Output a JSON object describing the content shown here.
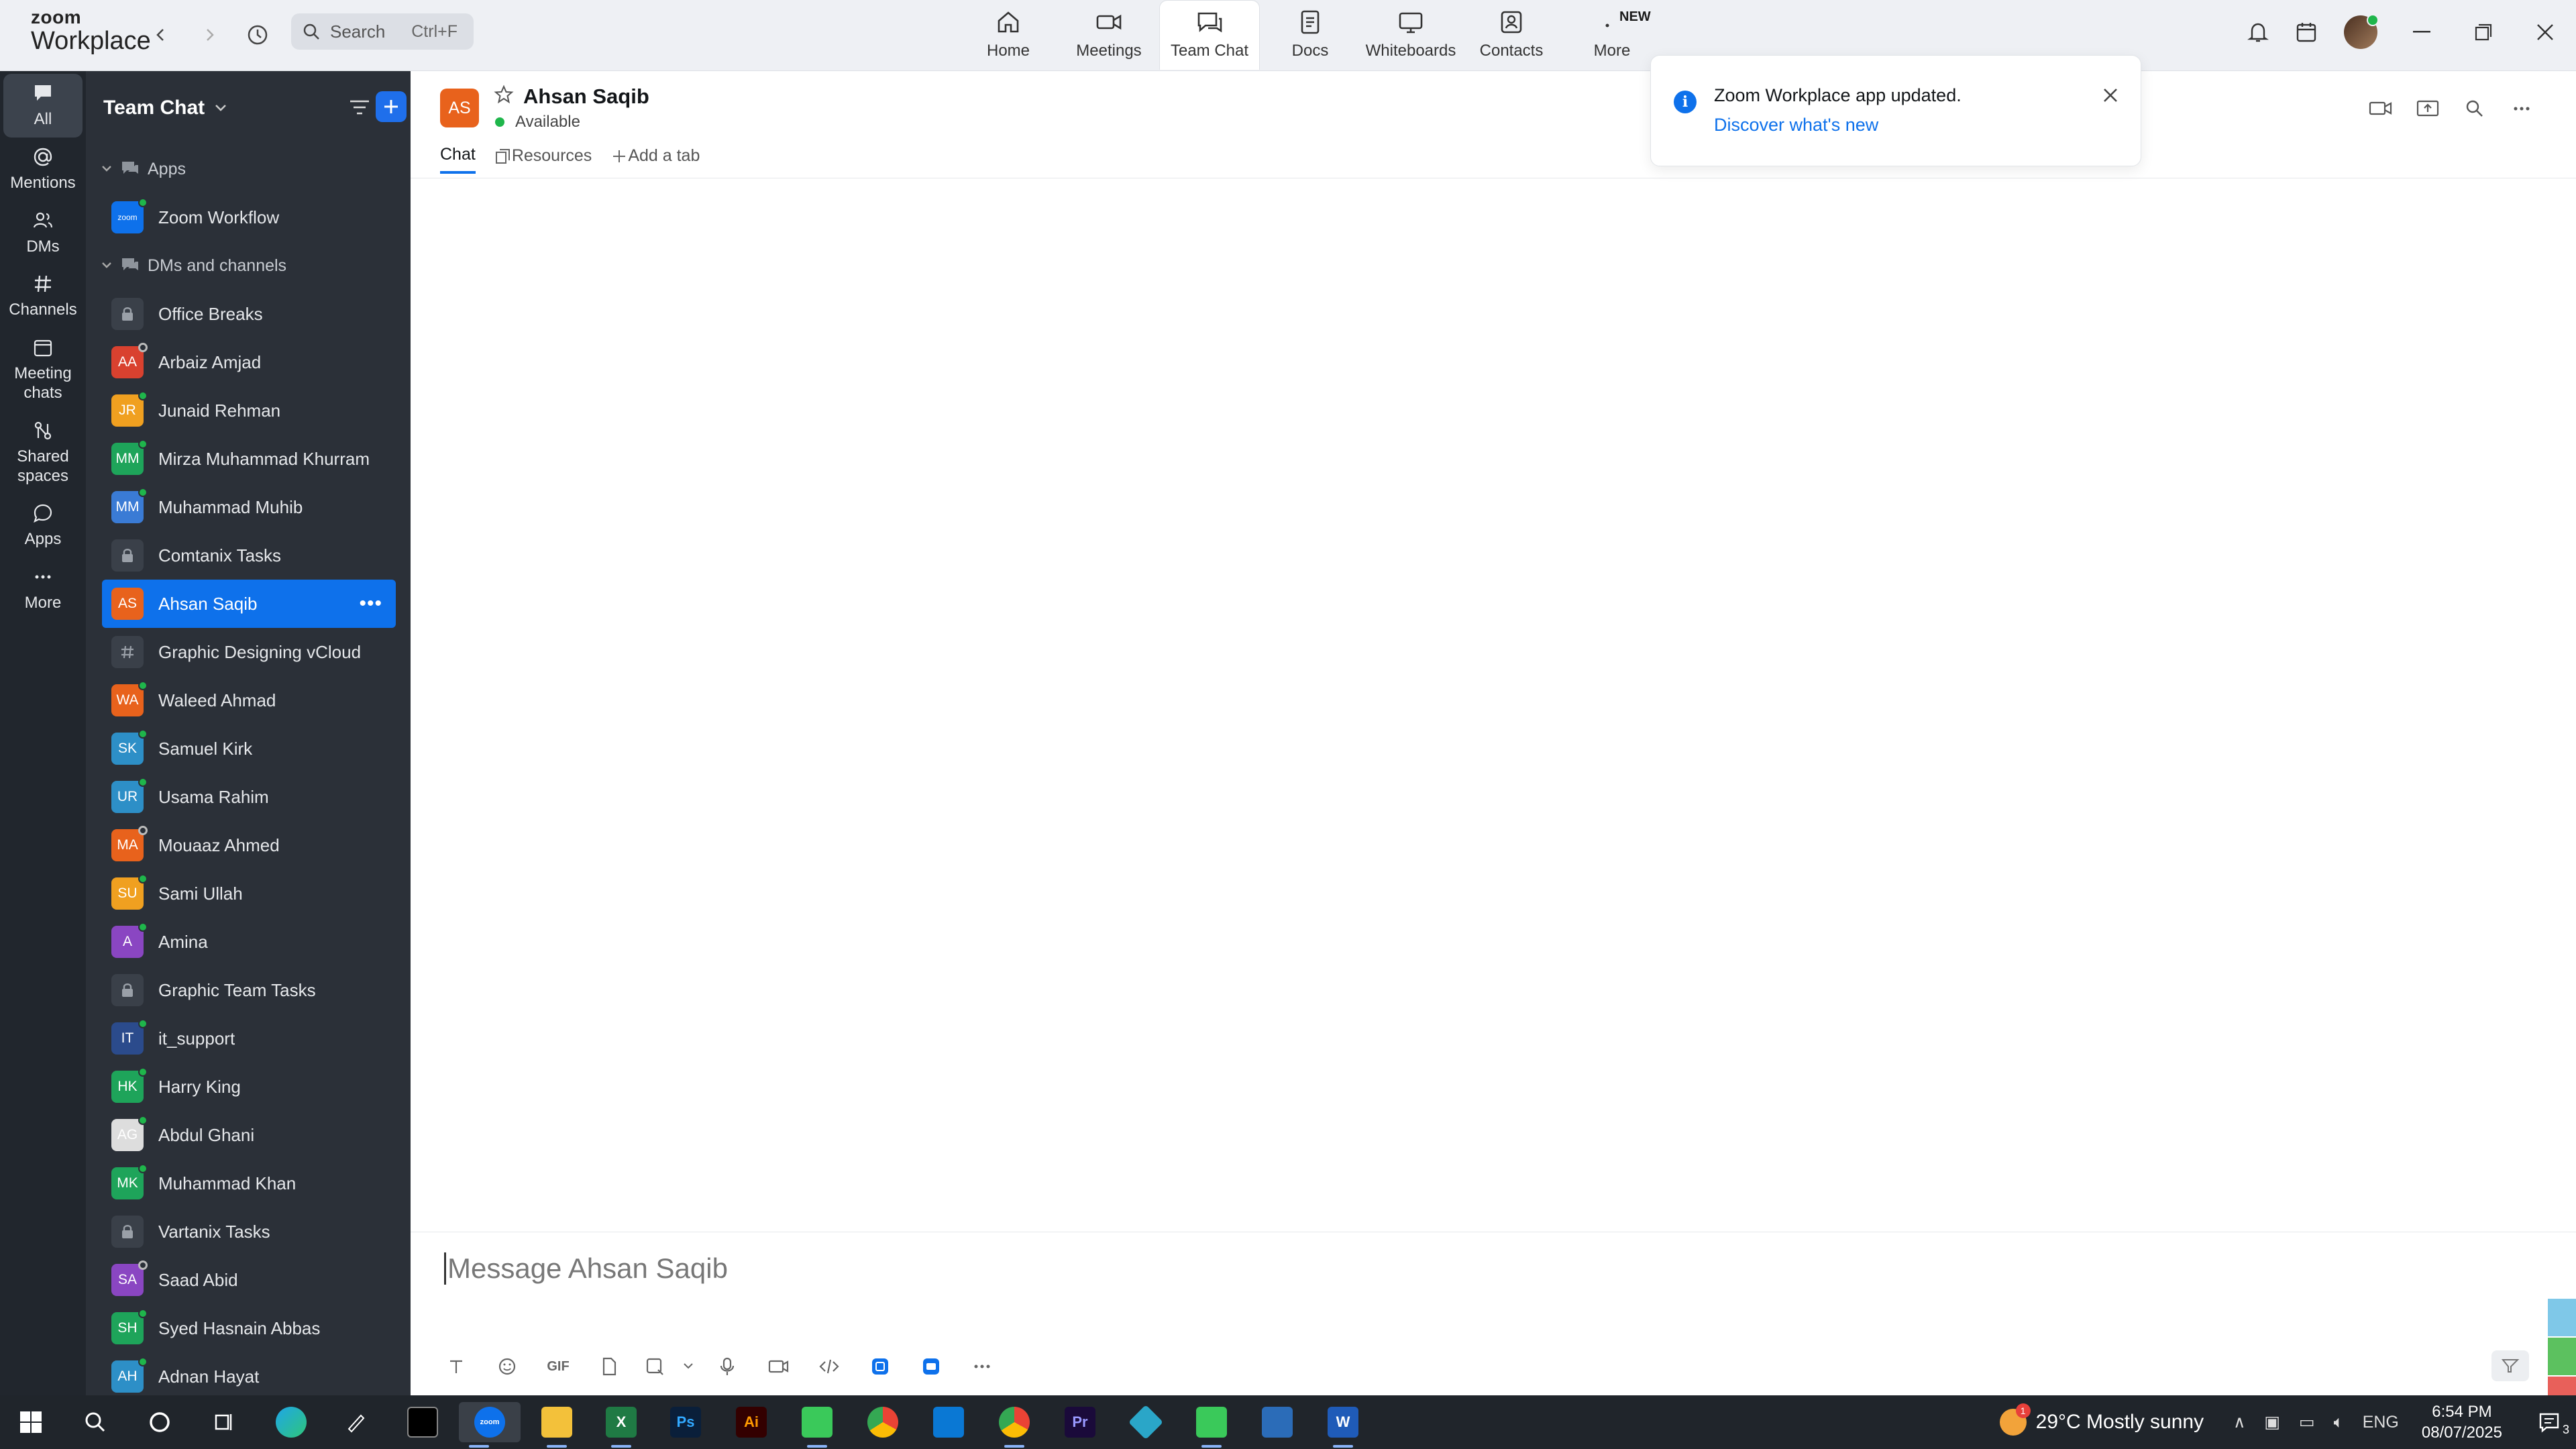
{
  "app": {
    "logo_line1": "zoom",
    "logo_line2": "Workplace"
  },
  "search": {
    "placeholder": "Search",
    "shortcut": "Ctrl+F"
  },
  "topnav": [
    {
      "label": "Home",
      "icon": "home-icon"
    },
    {
      "label": "Meetings",
      "icon": "video-camera-icon"
    },
    {
      "label": "Team Chat",
      "icon": "chat-bubble-icon",
      "active": true
    },
    {
      "label": "Docs",
      "icon": "document-icon"
    },
    {
      "label": "Whiteboards",
      "icon": "whiteboard-icon"
    },
    {
      "label": "Contacts",
      "icon": "contact-card-icon"
    },
    {
      "label": "More",
      "icon": "more-dots-icon",
      "badge": "NEW"
    }
  ],
  "rail": [
    {
      "label": "All",
      "active": true
    },
    {
      "label": "Mentions"
    },
    {
      "label": "DMs"
    },
    {
      "label": "Channels"
    },
    {
      "label": "Meeting chats"
    },
    {
      "label": "Shared spaces"
    },
    {
      "label": "Apps"
    },
    {
      "label": "More"
    }
  ],
  "sidebar": {
    "title": "Team Chat",
    "apps_label": "Apps",
    "dms_label": "DMs and channels",
    "apps": [
      {
        "name": "Zoom Workflow",
        "initials": "zoom",
        "color": "#0e71eb"
      }
    ],
    "items": [
      {
        "name": "Office Breaks",
        "type": "lock"
      },
      {
        "name": "Arbaiz Amjad",
        "initials": "AA",
        "color": "#d9412f",
        "status": "off"
      },
      {
        "name": "Junaid Rehman",
        "initials": "JR",
        "color": "#f0a020",
        "status": "on"
      },
      {
        "name": "Mirza Muhammad Khurram",
        "initials": "MM",
        "color": "#1ea45a",
        "status": "on"
      },
      {
        "name": "Muhammad Muhib",
        "initials": "MM",
        "color": "#3a7bd5",
        "status": "on"
      },
      {
        "name": "Comtanix Tasks",
        "type": "lock"
      },
      {
        "name": "Ahsan Saqib",
        "initials": "AS",
        "color": "#e8621c",
        "active": true
      },
      {
        "name": "Graphic Designing vCloud",
        "type": "hash"
      },
      {
        "name": "Waleed Ahmad",
        "initials": "WA",
        "color": "#e8621c",
        "status": "on"
      },
      {
        "name": "Samuel Kirk",
        "initials": "SK",
        "color": "#2d8fc7",
        "status": "on"
      },
      {
        "name": "Usama Rahim",
        "initials": "UR",
        "color": "#2d8fc7",
        "status": "on"
      },
      {
        "name": "Mouaaz Ahmed",
        "initials": "MA",
        "color": "#e8621c",
        "status": "off"
      },
      {
        "name": "Sami Ullah",
        "initials": "SU",
        "color": "#f0a020",
        "status": "on"
      },
      {
        "name": "Amina",
        "initials": "A",
        "color": "#8a46c2",
        "status": "on"
      },
      {
        "name": "Graphic Team Tasks",
        "type": "lock"
      },
      {
        "name": "it_support",
        "initials": "IT",
        "color": "#2b4b8c",
        "status": "on"
      },
      {
        "name": "Harry King",
        "initials": "HK",
        "color": "#1ea45a",
        "status": "on"
      },
      {
        "name": "Abdul Ghani",
        "initials": "AG",
        "color": "#dddddd",
        "status": "on"
      },
      {
        "name": "Muhammad Khan",
        "initials": "MK",
        "color": "#1ea45a",
        "status": "on"
      },
      {
        "name": "Vartanix Tasks",
        "type": "lock"
      },
      {
        "name": "Saad Abid",
        "initials": "SA",
        "color": "#8a46c2",
        "status": "off"
      },
      {
        "name": "Syed Hasnain Abbas",
        "initials": "SH",
        "color": "#1ea45a",
        "status": "on"
      },
      {
        "name": "Adnan Hayat",
        "initials": "AH",
        "color": "#2d8fc7",
        "status": "on"
      }
    ]
  },
  "chat": {
    "initials": "AS",
    "name": "Ahsan Saqib",
    "status": "Available",
    "tabs": [
      "Chat",
      "Resources",
      "Add a tab"
    ],
    "composer_placeholder": "Message Ahsan Saqib",
    "gif_label": "GIF"
  },
  "toast": {
    "message": "Zoom Workplace app updated.",
    "link": "Discover what's new"
  },
  "taskbar": {
    "weather": "29°C  Mostly sunny",
    "lang": "ENG",
    "time": "6:54 PM",
    "date": "08/07/2025",
    "notifications": "3"
  }
}
